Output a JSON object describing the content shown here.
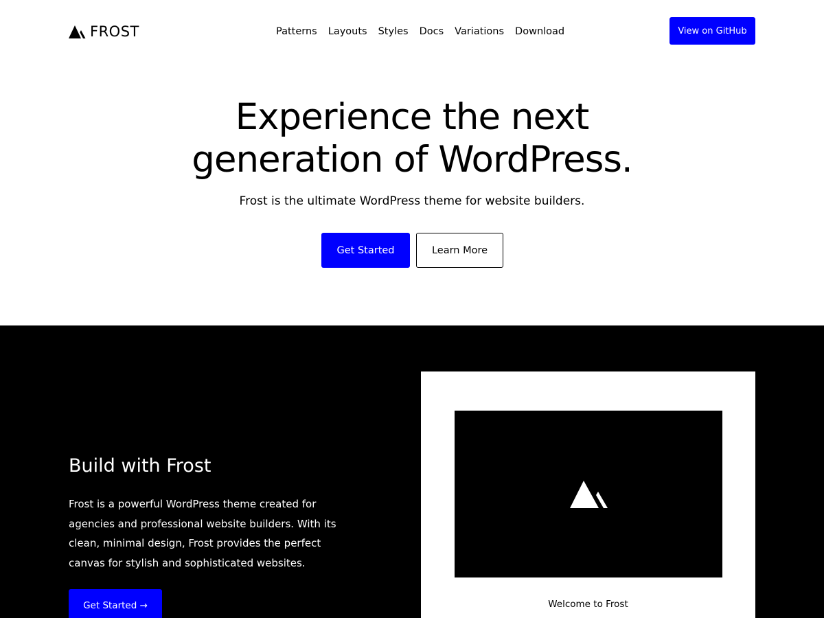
{
  "header": {
    "logo_text": "FROST",
    "nav": [
      "Patterns",
      "Layouts",
      "Styles",
      "Docs",
      "Variations",
      "Download"
    ],
    "cta_label": "View on GitHub"
  },
  "hero": {
    "title_line1": "Experience the next",
    "title_line2": "generation of WordPress.",
    "subtitle": "Frost is the ultimate WordPress theme for website builders.",
    "primary_label": "Get Started",
    "secondary_label": "Learn More"
  },
  "feature": {
    "title": "Build with Frost",
    "text": "Frost is a powerful WordPress theme created for agencies and professional website builders. With its clean, minimal design, Frost provides the perfect canvas for stylish and sophisticated websites.",
    "button_label": "Get Started →",
    "preview_caption": "Welcome to Frost"
  },
  "colors": {
    "accent": "#0000ff",
    "dark_bg": "#000000",
    "light_bg": "#ffffff"
  },
  "icons": {
    "logo": "frost-mountain-icon"
  }
}
